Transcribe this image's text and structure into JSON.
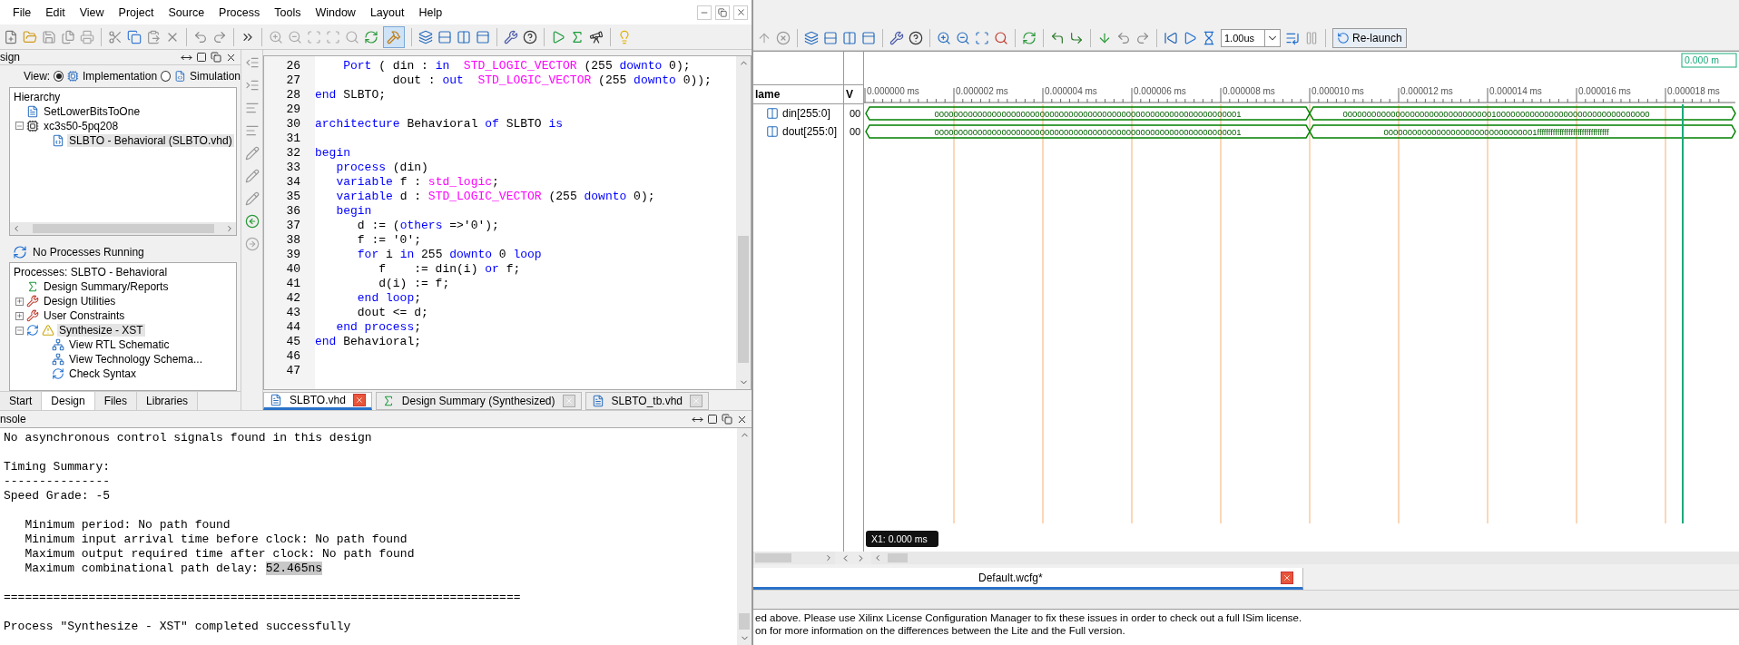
{
  "ise": {
    "menu": [
      "File",
      "Edit",
      "View",
      "Project",
      "Source",
      "Process",
      "Tools",
      "Window",
      "Layout",
      "Help"
    ],
    "design_panel": {
      "title": "sign",
      "view_label": "View:",
      "views": [
        {
          "label": "Implementation",
          "selected": true
        },
        {
          "label": "Simulation",
          "selected": false
        }
      ],
      "hierarchy_title": "Hierarchy",
      "hierarchy": [
        {
          "label": "SetLowerBitsToOne",
          "kind": "project",
          "selected": false
        },
        {
          "label": "xc3s50-5pq208",
          "kind": "chip",
          "selected": false,
          "expanded": true,
          "children": [
            {
              "label": "SLBTO - Behavioral (SLBTO.vhd)",
              "kind": "module",
              "selected": true
            }
          ]
        }
      ],
      "status": "No Processes Running",
      "processes_title": "Processes: SLBTO - Behavioral",
      "processes": [
        {
          "label": "Design Summary/Reports",
          "kind": "summary",
          "selected": false
        },
        {
          "label": "Design Utilities",
          "kind": "tools",
          "selected": false,
          "expanded": false
        },
        {
          "label": "User Constraints",
          "kind": "tools",
          "selected": false,
          "expanded": false
        },
        {
          "label": "Synthesize - XST",
          "kind": "synth",
          "selected": true,
          "expanded": true,
          "children": [
            {
              "label": "View RTL Schematic",
              "kind": "schematic",
              "selected": false
            },
            {
              "label": "View Technology Schema...",
              "kind": "schematic",
              "selected": false
            },
            {
              "label": "Check Syntax",
              "kind": "check",
              "selected": false
            }
          ]
        }
      ],
      "tabs": [
        {
          "label": "Start",
          "selected": false
        },
        {
          "label": "Design",
          "selected": true
        },
        {
          "label": "Files",
          "selected": false
        },
        {
          "label": "Libraries",
          "selected": false
        }
      ]
    },
    "editor": {
      "lines": [
        {
          "number": "26",
          "tokens": [
            {
              "t": "    Port",
              "kind": "keyword"
            },
            {
              "t": " ( din : ",
              "kind": "plain"
            },
            {
              "t": "in",
              "kind": "keyword"
            },
            {
              "t": "  STD_LOGIC_VECTOR",
              "kind": "type"
            },
            {
              "t": " (255 ",
              "kind": "plain"
            },
            {
              "t": "downto",
              "kind": "keyword"
            },
            {
              "t": " 0);",
              "kind": "plain"
            }
          ]
        },
        {
          "number": "27",
          "tokens": [
            {
              "t": "           dout : ",
              "kind": "plain"
            },
            {
              "t": "out",
              "kind": "keyword"
            },
            {
              "t": "  STD_LOGIC_VECTOR",
              "kind": "type"
            },
            {
              "t": " (255 ",
              "kind": "plain"
            },
            {
              "t": "downto",
              "kind": "keyword"
            },
            {
              "t": " 0));",
              "kind": "plain"
            }
          ]
        },
        {
          "number": "28",
          "tokens": [
            {
              "t": "end",
              "kind": "keyword"
            },
            {
              "t": " SLBTO;",
              "kind": "plain"
            }
          ]
        },
        {
          "number": "29"
        },
        {
          "number": "30",
          "tokens": [
            {
              "t": "architecture",
              "kind": "keyword"
            },
            {
              "t": " Behavioral ",
              "kind": "plain"
            },
            {
              "t": "of",
              "kind": "keyword"
            },
            {
              "t": " SLBTO ",
              "kind": "plain"
            },
            {
              "t": "is",
              "kind": "keyword"
            }
          ]
        },
        {
          "number": "31"
        },
        {
          "number": "32",
          "tokens": [
            {
              "t": "begin",
              "kind": "keyword"
            }
          ]
        },
        {
          "number": "33",
          "tokens": [
            {
              "t": "   process",
              "kind": "keyword"
            },
            {
              "t": " (din)",
              "kind": "plain"
            }
          ]
        },
        {
          "number": "34",
          "tokens": [
            {
              "t": "   variable",
              "kind": "keyword"
            },
            {
              "t": " f : ",
              "kind": "plain"
            },
            {
              "t": "std_logic",
              "kind": "type"
            },
            {
              "t": ";",
              "kind": "plain"
            }
          ]
        },
        {
          "number": "35",
          "tokens": [
            {
              "t": "   variable",
              "kind": "keyword"
            },
            {
              "t": " d : ",
              "kind": "plain"
            },
            {
              "t": "STD_LOGIC_VECTOR",
              "kind": "type"
            },
            {
              "t": " (255 ",
              "kind": "plain"
            },
            {
              "t": "downto",
              "kind": "keyword"
            },
            {
              "t": " 0);",
              "kind": "plain"
            }
          ]
        },
        {
          "number": "36",
          "tokens": [
            {
              "t": "   begin",
              "kind": "keyword"
            }
          ]
        },
        {
          "number": "37",
          "tokens": [
            {
              "t": "      d := (",
              "kind": "plain"
            },
            {
              "t": "others",
              "kind": "keyword"
            },
            {
              "t": " =>'0');",
              "kind": "plain"
            }
          ]
        },
        {
          "number": "38",
          "tokens": [
            {
              "t": "      f := '0';",
              "kind": "plain"
            }
          ]
        },
        {
          "number": "39",
          "tokens": [
            {
              "t": "      for",
              "kind": "keyword"
            },
            {
              "t": " i ",
              "kind": "plain"
            },
            {
              "t": "in",
              "kind": "keyword"
            },
            {
              "t": " 255 ",
              "kind": "plain"
            },
            {
              "t": "downto",
              "kind": "keyword"
            },
            {
              "t": " 0 ",
              "kind": "plain"
            },
            {
              "t": "loop",
              "kind": "keyword"
            }
          ]
        },
        {
          "number": "40",
          "tokens": [
            {
              "t": "         f    := din(i) ",
              "kind": "plain"
            },
            {
              "t": "or",
              "kind": "keyword"
            },
            {
              "t": " f;",
              "kind": "plain"
            }
          ]
        },
        {
          "number": "41",
          "tokens": [
            {
              "t": "         d(i) := f;",
              "kind": "plain"
            }
          ]
        },
        {
          "number": "42",
          "tokens": [
            {
              "t": "      end loop",
              "kind": "keyword"
            },
            {
              "t": ";",
              "kind": "plain"
            }
          ]
        },
        {
          "number": "43",
          "tokens": [
            {
              "t": "      dout <= d;",
              "kind": "plain"
            }
          ]
        },
        {
          "number": "44",
          "tokens": [
            {
              "t": "   end process",
              "kind": "keyword"
            },
            {
              "t": ";",
              "kind": "plain"
            }
          ]
        },
        {
          "number": "45",
          "tokens": [
            {
              "t": "end",
              "kind": "keyword"
            },
            {
              "t": " Behavioral;",
              "kind": "plain"
            }
          ]
        },
        {
          "number": "46"
        },
        {
          "number": "47"
        }
      ],
      "tabs": [
        {
          "label": "SLBTO.vhd",
          "kind": "file",
          "selected": true
        },
        {
          "label": "Design Summary (Synthesized)",
          "kind": "summary",
          "selected": false
        },
        {
          "label": "SLBTO_tb.vhd",
          "kind": "file",
          "selected": false
        }
      ]
    },
    "console": {
      "title": "nsole",
      "lines": [
        {
          "kind": "text",
          "text": "No asynchronous control signals found in this design"
        },
        {
          "kind": "blank"
        },
        {
          "kind": "text",
          "text": "Timing Summary:"
        },
        {
          "kind": "text",
          "text": "---------------"
        },
        {
          "kind": "text",
          "text": "Speed Grade: -5"
        },
        {
          "kind": "blank"
        },
        {
          "kind": "text",
          "text": "   Minimum period: No path found"
        },
        {
          "kind": "text",
          "text": "   Minimum input arrival time before clock: No path found"
        },
        {
          "kind": "text",
          "text": "   Maximum output required time after clock: No path found"
        },
        {
          "kind": "text",
          "text": "   Maximum combinational path delay: ",
          "selection": "52.465ns"
        },
        {
          "kind": "blank"
        },
        {
          "kind": "text",
          "text": "========================================================================="
        },
        {
          "kind": "blank"
        },
        {
          "kind": "text",
          "text": "Process \"Synthesize - XST\" completed successfully"
        }
      ]
    }
  },
  "isim": {
    "run_time": "1.00us",
    "relaunch": "Re-launch",
    "columns": [
      "lame",
      "V"
    ],
    "cursor_label": "0.000 m",
    "ruler": [
      "0.000000 ms",
      "0.000002 ms",
      "0.000004 ms",
      "0.000006 ms",
      "0.000008 ms",
      "0.000010 ms",
      "0.000012 ms",
      "0.000014 ms",
      "0.000016 ms",
      "0.000018 ms"
    ],
    "signals": [
      {
        "name": "din[255:0]",
        "value": "00",
        "segments": [
          "0000000000000000000000000000000000000000000000000000000000000001",
          "0000000000000000000000000000000100000000000000000000000000000000"
        ]
      },
      {
        "name": "dout[255:0]",
        "value": "00",
        "segments": [
          "0000000000000000000000000000000000000000000000000000000000000001",
          "00000000000000000000000000000001ffffffffffffffffffffffffffffffff"
        ]
      }
    ],
    "x1_label": "X1: 0.000 ms",
    "tab": "Default.wcfg*",
    "messages": [
      "ed above. Please use Xilinx License Configuration Manager to fix these issues in order to check out a full ISim license.",
      "on for more information on the differences between the Lite and the Full version."
    ]
  }
}
